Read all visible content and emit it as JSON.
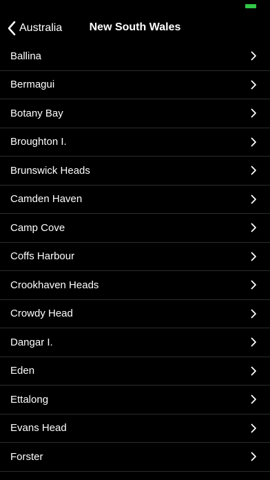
{
  "status_bar": {
    "battery_color": "#33c748"
  },
  "nav": {
    "back_label": "Australia",
    "back_icon": "chevron-left-icon",
    "title": "New South Wales"
  },
  "list": {
    "item_icon": "chevron-right-icon",
    "items": [
      {
        "label": "Ballina"
      },
      {
        "label": "Bermagui"
      },
      {
        "label": "Botany Bay"
      },
      {
        "label": "Broughton I."
      },
      {
        "label": "Brunswick Heads"
      },
      {
        "label": "Camden Haven"
      },
      {
        "label": "Camp Cove"
      },
      {
        "label": "Coffs Harbour"
      },
      {
        "label": "Crookhaven Heads"
      },
      {
        "label": "Crowdy Head"
      },
      {
        "label": "Dangar I."
      },
      {
        "label": "Eden"
      },
      {
        "label": "Ettalong"
      },
      {
        "label": "Evans Head"
      },
      {
        "label": "Forster"
      }
    ]
  }
}
